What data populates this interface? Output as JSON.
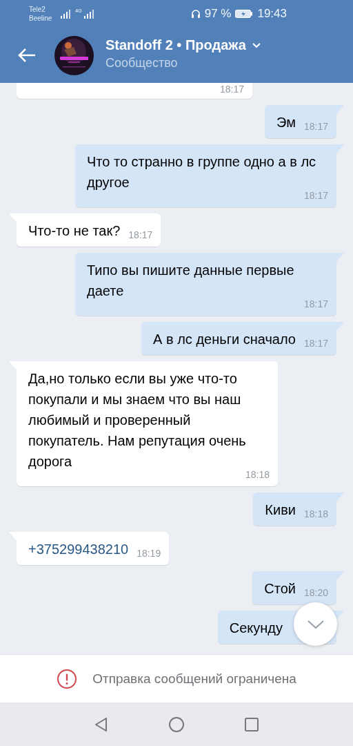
{
  "status_bar": {
    "carriers": [
      "Tele2",
      "Beeline"
    ],
    "network": "4G",
    "battery_percent": "97 %",
    "time": "19:43"
  },
  "header": {
    "title": "Standoff 2 • Продажа",
    "subtitle": "Сообщество"
  },
  "messages": [
    {
      "outgoing": false,
      "kind": "cut",
      "time": "18:17"
    },
    {
      "outgoing": true,
      "kind": "text",
      "text": "Эм",
      "time": "18:17"
    },
    {
      "outgoing": true,
      "kind": "text",
      "text": "Что то странно в группе одно а в лс другое",
      "time": "18:17"
    },
    {
      "outgoing": false,
      "kind": "text",
      "text": "Что-то не так?",
      "time": "18:17"
    },
    {
      "outgoing": true,
      "kind": "text",
      "text": "Типо вы пишите данные первые даете",
      "time": "18:17"
    },
    {
      "outgoing": true,
      "kind": "text",
      "text": "А в лс деньги сначало",
      "time": "18:17"
    },
    {
      "outgoing": false,
      "kind": "text",
      "text": "Да,но только если вы уже что-то покупали и мы знаем что вы наш любимый и проверенный покупатель. Нам репутация очень дорога",
      "time": "18:18"
    },
    {
      "outgoing": true,
      "kind": "text",
      "text": "Киви",
      "time": "18:18"
    },
    {
      "outgoing": false,
      "kind": "link",
      "text": "+375299438210",
      "time": "18:19"
    },
    {
      "outgoing": true,
      "kind": "text",
      "text": "Стой",
      "time": "18:20"
    },
    {
      "outgoing": true,
      "kind": "text",
      "text": "Секунду"
    }
  ],
  "notice": {
    "text": "Отправка сообщений ограничена"
  }
}
